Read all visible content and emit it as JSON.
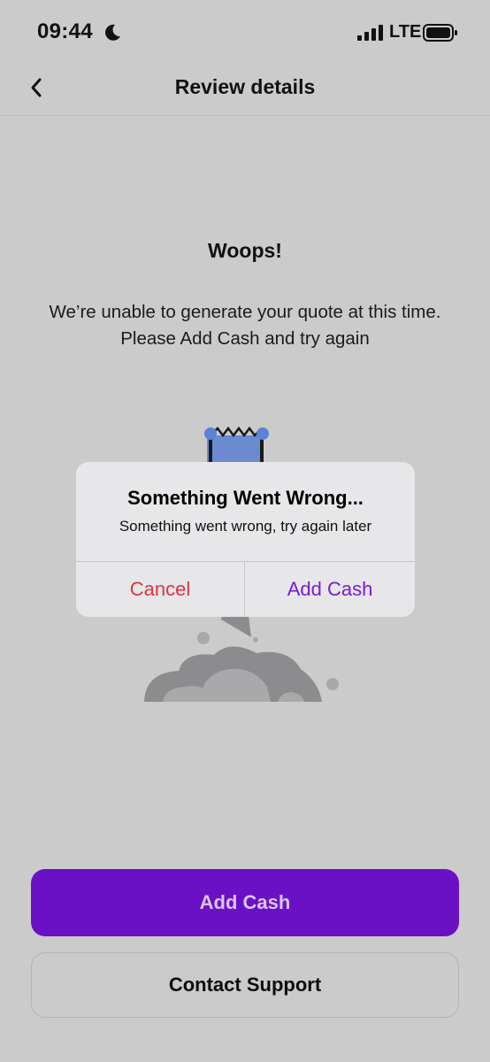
{
  "status_bar": {
    "time": "09:44",
    "network": "LTE",
    "icons": [
      "moon-icon",
      "signal-icon",
      "battery-icon"
    ]
  },
  "header": {
    "title": "Review details",
    "back_icon": "chevron-left-icon"
  },
  "main": {
    "title": "Woops!",
    "message": "We’re unable to generate your quote at this time. Please Add Cash and try again"
  },
  "dialog": {
    "title": "Something Went Wrong...",
    "message": "Something went wrong, try again later",
    "cancel_label": "Cancel",
    "confirm_label": "Add Cash"
  },
  "footer": {
    "primary_label": "Add Cash",
    "secondary_label": "Contact Support"
  },
  "colors": {
    "background": "#cbcbcb",
    "accent_purple": "#6a11c5",
    "dialog_cancel": "#e2323f",
    "dialog_confirm": "#7a1ad8"
  }
}
